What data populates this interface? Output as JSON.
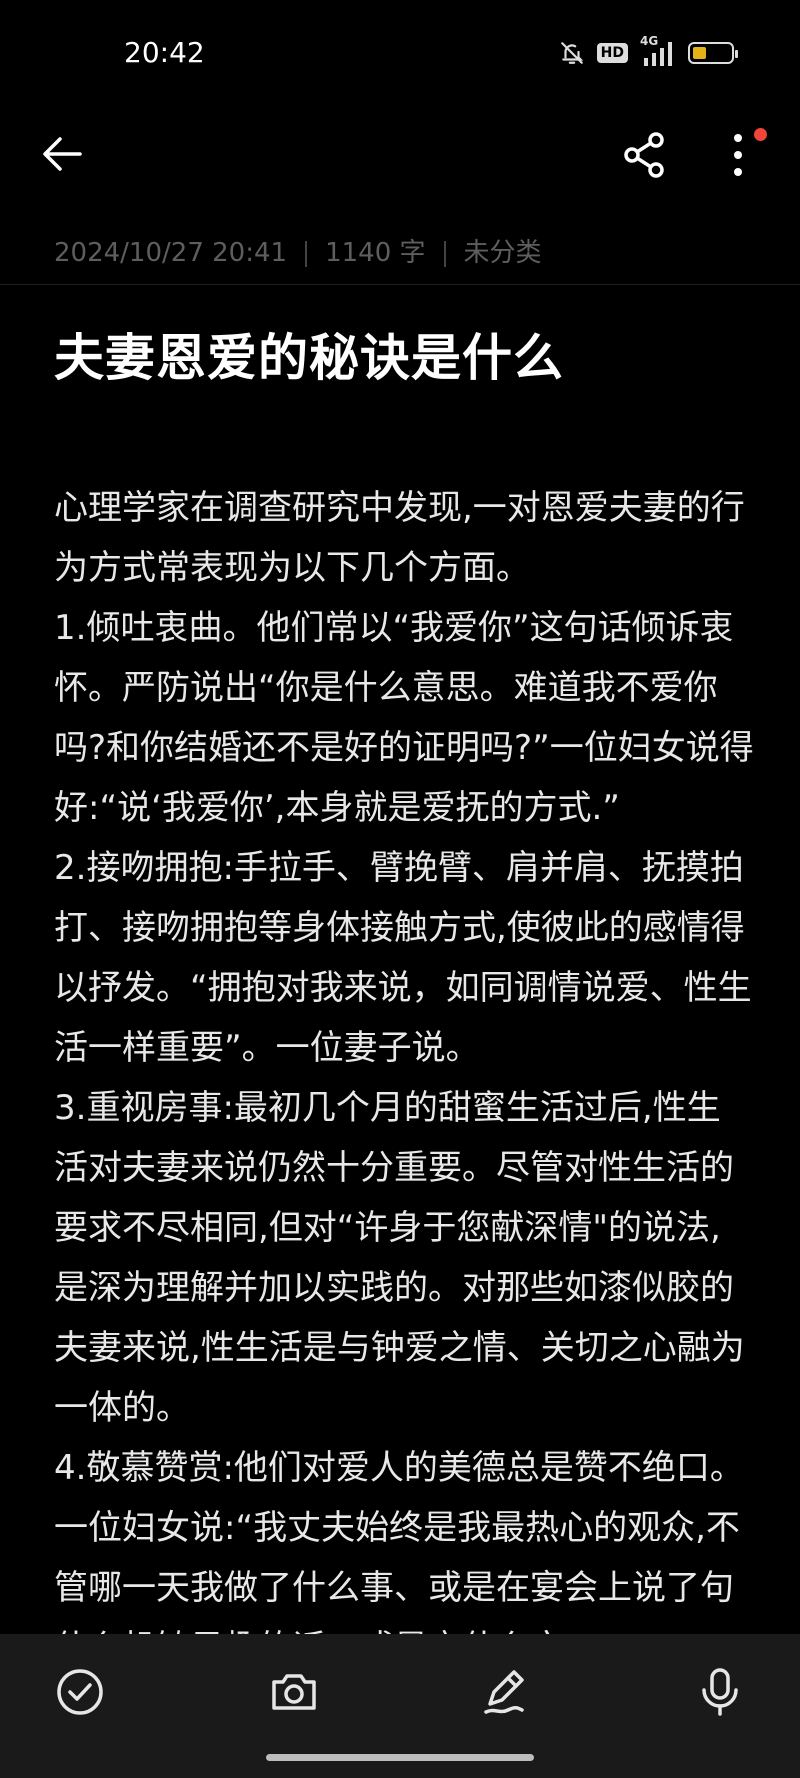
{
  "status_bar": {
    "time": "20:42",
    "network": "4G",
    "hd": "HD",
    "battery_level": 0.35,
    "battery_color": "#e3b21a"
  },
  "toolbar": {
    "back_icon": "arrow-left-icon",
    "share_icon": "share-icon",
    "more_icon": "more-vertical-icon",
    "notification_dot_color": "#f0453a"
  },
  "note": {
    "date": "2024/10/27 20:41",
    "word_count": "1140 字",
    "category": "未分类",
    "title": "夫妻恩爱的秘诀是什么",
    "paragraphs": [
      "心理学家在调查研究中发现,一对恩爱夫妻的行为方式常表现为以下几个方面。",
      "1.倾吐衷曲。他们常以“我爱你”这句话倾诉衷怀。严防说出“你是什么意思。难道我不爱你吗?和你结婚还不是好的证明吗?”一位妇女说得好:“说‘我爱你’,本身就是爱抚的方式.”",
      "2.接吻拥抱:手拉手、臂挽臂、肩并肩、抚摸拍打、接吻拥抱等身体接触方式,使彼此的感情得以抒发。“拥抱对我来说，如同调情说爱、性生活一样重要”。一位妻子说。",
      "3.重视房事:最初几个月的甜蜜生活过后,性生活对夫妻来说仍然十分重要。尽管对性生活的要求不尽相同,但对“许身于您献深情\"的说法,是深为理解并加以实践的。对那些如漆似胶的夫妻来说,性生活是与钟爱之情、关切之心融为一体的。",
      "4.敬慕赞赏:他们对爱人的美德总是赞不绝口。一位妇女说:“我丈夫始终是我最热心的观众,不管哪一天我做了什么事、或是在宴会上说了句什么机敏风趣的话，或是它什么文"
    ]
  },
  "bottom_bar": {
    "items": [
      "checkbox-icon",
      "camera-icon",
      "pen-icon",
      "microphone-icon"
    ]
  }
}
